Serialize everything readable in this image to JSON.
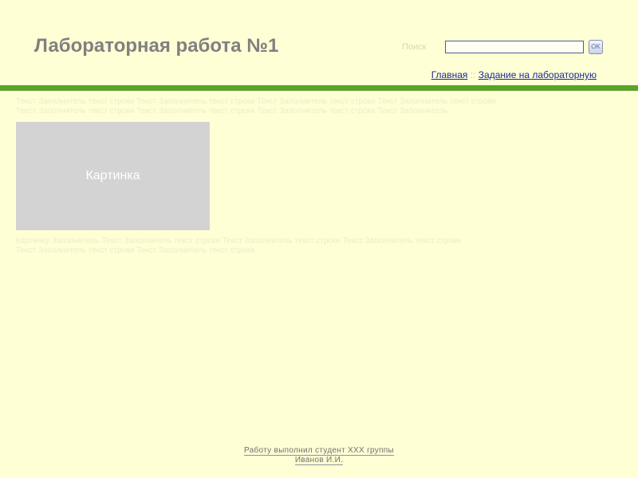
{
  "header": {
    "title": "Лабораторная работа №1"
  },
  "search": {
    "label": "Поиск",
    "value": "",
    "placeholder": "",
    "button_label": "OK"
  },
  "nav": {
    "items": [
      {
        "label": "Главная"
      },
      {
        "label": "Задание на лабораторную"
      }
    ],
    "separator": "::"
  },
  "content": {
    "paragraph_top": "Текст Заполнитель текст строки Текст Заполнитель текст строки Текст Заполнитель текст строки Текст Заполнитель текст строки Текст Заполнитель текст строки Текст Заполнитель текст строки Текст Заполнитель текст строки Текст Заполнитель",
    "image_caption": "Картинка",
    "paragraph_bottom": "Картинку Заполнитель Текст Заполнитель текст строки Текст Заполнитель текст строки Текст Заполнитель текст строки Текст Заполнитель текст строки Текст Заполнитель текст строки"
  },
  "footer": {
    "line1": "Работу выполнил студент ХХХ группы",
    "line2": "Иванов И.И."
  },
  "colors": {
    "background": "#FFFFD6",
    "accent_bar": "#5BA328",
    "title": "#808080",
    "link": "#1A2A9A",
    "image_placeholder": "#D3D3D3"
  }
}
